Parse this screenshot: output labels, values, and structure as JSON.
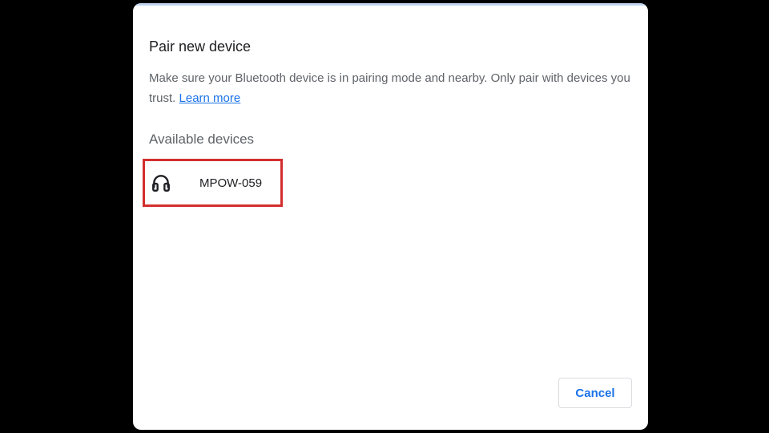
{
  "dialog": {
    "title": "Pair new device",
    "description": "Make sure your Bluetooth device is in pairing mode and nearby. Only pair with devices you trust.",
    "learn_more": "Learn more",
    "available_heading": "Available devices",
    "devices": [
      {
        "name": "MPOW-059",
        "icon": "headphones-icon"
      }
    ],
    "cancel_label": "Cancel"
  },
  "colors": {
    "background": "#000000",
    "dialog_bg": "#ffffff",
    "accent": "#1a73e8",
    "highlight_border": "#d32f2f"
  }
}
